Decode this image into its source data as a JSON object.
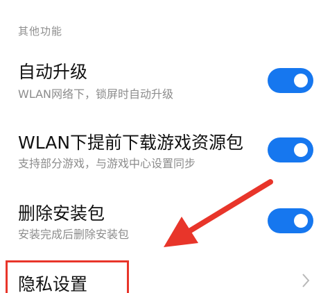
{
  "section": {
    "label": "其他功能"
  },
  "settings": [
    {
      "title": "自动升级",
      "subtitle": "WLAN网络下，锁屏时自动升级",
      "enabled": true
    },
    {
      "title": "WLAN下提前下载游戏资源包",
      "subtitle": "支持部分游戏，与游戏中心设置同步",
      "enabled": true
    },
    {
      "title": "删除安装包",
      "subtitle": "安装完成后删除安装包",
      "enabled": true
    }
  ],
  "privacy": {
    "title": "隐私设置"
  },
  "colors": {
    "toggle_on": "#1677ef",
    "annotation": "#e8352a"
  },
  "icons": {
    "privacy_chevron": "chevron-right-icon"
  }
}
